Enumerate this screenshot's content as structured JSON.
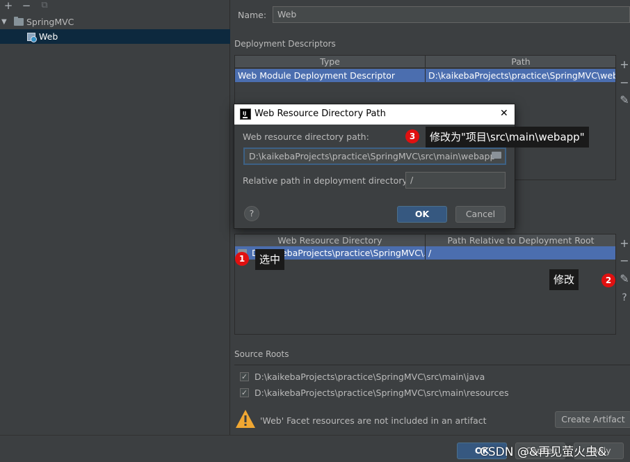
{
  "tree": {
    "toolbar": [
      "+",
      "−",
      "⧉"
    ],
    "root_label": "SpringMVC",
    "child_label": "Web"
  },
  "form": {
    "name_label": "Name:",
    "name_value": "Web",
    "deployment_descriptors_label": "Deployment Descriptors",
    "dd_table": {
      "headers": [
        "Type",
        "Path"
      ],
      "row": [
        "Web Module Deployment Descriptor",
        "D:\\kaikebaProjects\\practice\\SpringMVC\\web\\W"
      ]
    },
    "web_resource_table": {
      "headers": [
        "Web Resource Directory",
        "Path Relative to Deployment Root"
      ],
      "row": [
        "D:\\kaikebaProjects\\practice\\SpringMVC\\...",
        "/"
      ]
    },
    "source_roots_label": "Source Roots",
    "source_roots": [
      "D:\\kaikebaProjects\\practice\\SpringMVC\\src\\main\\java",
      "D:\\kaikebaProjects\\practice\\SpringMVC\\src\\main\\resources"
    ],
    "warning_text": "'Web' Facet resources are not included in an artifact",
    "create_artifact_label": "Create Artifact"
  },
  "side_buttons": {
    "add": "+",
    "remove": "−",
    "edit": "✎",
    "help": "?"
  },
  "dialog": {
    "title": "Web Resource Directory Path",
    "close": "✕",
    "path_label": "Web resource directory path:",
    "path_value": "D:\\kaikebaProjects\\practice\\SpringMVC\\src\\main\\webapp",
    "relative_label": "Relative path in deployment directory:",
    "relative_value": "/",
    "help": "?",
    "ok_label": "OK",
    "cancel_label": "Cancel"
  },
  "annotations": {
    "n1": "1",
    "tip1": "选中",
    "n2": "2",
    "tip2": "修改",
    "n3": "3",
    "tip3": "修改为\"项目\\src\\main\\webapp\""
  },
  "bottom": {
    "ok_label": "OK",
    "cancel_label": "Cancel",
    "apply_label": "Apply",
    "watermark": "CSDN @&再见萤火虫&"
  },
  "colors": {
    "background": "#3c3f41",
    "selection": "#4b6eaf",
    "badge": "#e01010",
    "tip_bg": "#1a1a1a",
    "warning": "#f0a732"
  }
}
